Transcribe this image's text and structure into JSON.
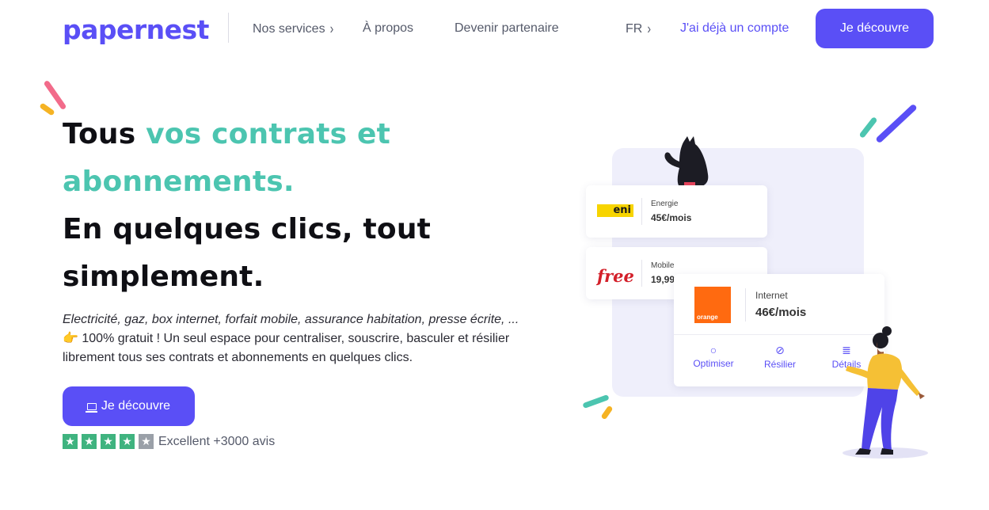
{
  "nav": {
    "logo": "papernest",
    "services": "Nos services",
    "about": "À propos",
    "partner": "Devenir partenaire",
    "lang": "FR",
    "login": "J'ai déjà un compte",
    "cta": "Je découvre"
  },
  "hero": {
    "title_1": "Tous ",
    "title_accent": "vos contrats et abonnements.",
    "title_2": "En quelques clics, tout simplement.",
    "desc_italic": "Electricité, gaz, box internet, forfait mobile, assurance habitation, presse écrite, ...",
    "desc_emoji": "👉",
    "desc_text": " 100% gratuit ! Un seul espace pour centraliser, souscrire, basculer et résilier librement tous ses contrats et abonnements en quelques clics.",
    "cta": "Je découvre",
    "rating_text": "Excellent +3000 avis",
    "rating_stars": 5
  },
  "illustration": {
    "card_eni": {
      "logo": "eni",
      "label": "Energie",
      "price": "45€/mois"
    },
    "card_free": {
      "logo": "free",
      "label": "Mobile",
      "price": "19,99"
    },
    "card_orange": {
      "logo": "orange",
      "label": "Internet",
      "price": "46€/mois"
    },
    "actions": [
      "Optimiser",
      "Résilier",
      "Détails"
    ]
  },
  "colors": {
    "brand": "#5a4ff6",
    "accent": "#4cc5b0",
    "star": "#3fb37f"
  }
}
